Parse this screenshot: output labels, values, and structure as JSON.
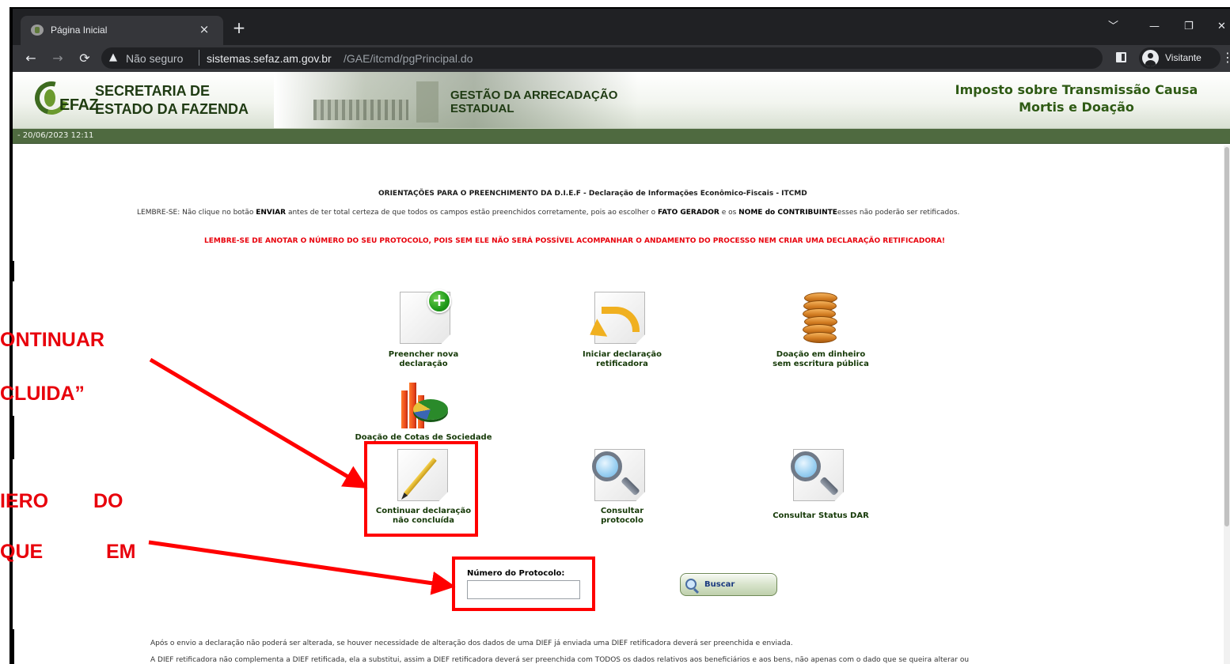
{
  "browser": {
    "tab_title": "Página Inicial",
    "tab_close": "×",
    "new_tab": "+",
    "url_warning": "Não seguro",
    "url_domain": "sistemas.sefaz.am.gov.br",
    "url_path": "/GAE/itcmd/pgPrincipal.do",
    "profile_label": "Visitante",
    "win_chevron": "﹀",
    "win_minimize": "—",
    "win_restore": "❐",
    "win_close": "✕"
  },
  "header": {
    "logo_text": "EFAZ",
    "org_line1": "SECRETARIA DE",
    "org_line2": "ESTADO DA FAZENDA",
    "gestao_line1": "GESTÃO DA ARRECADAÇÃO",
    "gestao_line2": "ESTADUAL",
    "system_title": "Imposto sobre Transmissão Causa Mortis e Doação",
    "date": "- 20/06/2023 12:11"
  },
  "notice": {
    "title": "ORIENTAÇÕES PARA O PREENCHIMENTO DA D.I.E.F - Declaração de Informações Econômico-Fiscais - ITCMD",
    "lembre_prefix": "LEMBRE-SE: Não clique no botão ",
    "lembre_enviar": "ENVIAR",
    "lembre_mid": " antes de ter total certeza de que todos os campos estão preenchidos corretamente, pois ao escolher o ",
    "lembre_fato": "FATO GERADOR",
    "lembre_and": " e os ",
    "lembre_nome": "NOME do CONTRIBUINTE",
    "lembre_suffix": "esses não poderão ser retificados.",
    "warning": "LEMBRE-SE DE ANOTAR O NÚMERO DO SEU PROTOCOLO, POIS SEM ELE NÃO SERÁ POSSÍVEL ACOMPANHAR O ANDAMENTO DO PROCESSO NEM CRIAR UMA DECLARAÇÃO RETIFICADORA!"
  },
  "options": {
    "nova": {
      "line1": "Preencher nova",
      "line2": "declaração"
    },
    "retificadora": {
      "line1": "Iniciar declaração",
      "line2": "retificadora"
    },
    "doacao_dinheiro": {
      "line1": "Doação em dinheiro",
      "line2": "sem escritura pública"
    },
    "cotas": {
      "label": "Doação de Cotas de Sociedade"
    },
    "continuar": {
      "line1": "Continuar declaração",
      "line2": "não concluída"
    },
    "consultar_protocolo": {
      "line1": "Consultar",
      "line2": "protocolo"
    },
    "status_dar": {
      "label": "Consultar Status DAR"
    }
  },
  "protocol": {
    "label": "Número do Protocolo:",
    "value": "",
    "button": "Buscar"
  },
  "footer": {
    "line1": "Após o envio a declaração não poderá ser alterada, se houver necessidade de alteração dos dados de uma DIEF já enviada uma DIEF retificadora deverá ser preenchida e enviada.",
    "line2": "A DIEF retificadora não complementa a DIEF retificada, ela a substitui, assim a DIEF retificadora deverá ser preenchida com TODOS os dados relativos aos beneficiários e aos bens, não apenas com o dado que se queira alterar ou"
  },
  "annotation": {
    "line1": "ONTINUAR",
    "line2": "CLUIDA”",
    "line3a": "IERO",
    "line3b": "DO",
    "line4a": "QUE",
    "line4b": "EM",
    "color": "#e8000b"
  }
}
